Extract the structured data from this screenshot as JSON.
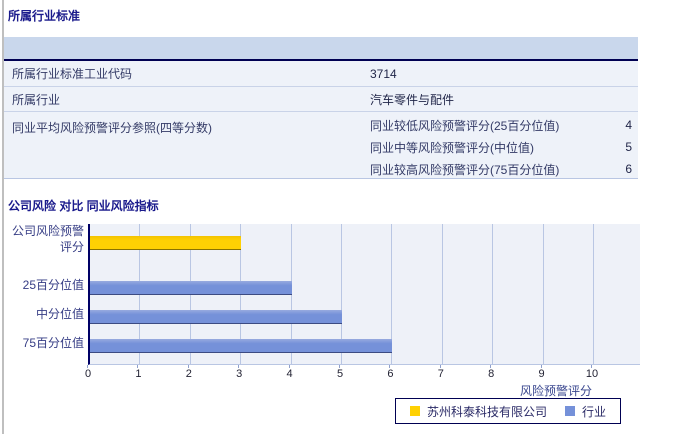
{
  "sections": {
    "industry_standard_title": "所属行业标准",
    "comparison_title": "公司风险 对比 同业风险指标"
  },
  "industry_table": {
    "rows": [
      {
        "label": "所属行业标准工业代码",
        "value": "3714"
      },
      {
        "label": "所属行业",
        "value": "汽车零件与配件"
      }
    ],
    "quartile_row": {
      "label": "同业平均风险预警评分参照(四等分数)",
      "items": [
        {
          "label": "同业较低风险预警评分(25百分位值)",
          "value": "4"
        },
        {
          "label": "同业中等风险预警评分(中位值)",
          "value": "5"
        },
        {
          "label": "同业较高风险预警评分(75百分位值)",
          "value": "6"
        }
      ]
    }
  },
  "chart_data": {
    "type": "bar",
    "orientation": "horizontal",
    "categories": [
      "公司风险预警评分",
      "25百分位值",
      "中分位值",
      "75百分位值"
    ],
    "category_display": [
      [
        "公司风险预警",
        "评分"
      ],
      [
        "25百分位值"
      ],
      [
        "中分位值"
      ],
      [
        "75百分位值"
      ]
    ],
    "series": [
      {
        "name": "苏州科泰科技有限公司",
        "color": "#FFD103",
        "color_top": "#F3C300",
        "color_edge": "#8A7200",
        "values": [
          3,
          null,
          null,
          null
        ]
      },
      {
        "name": "行业",
        "color": "#7591D9",
        "color_top": "#97AADF",
        "color_edge": "#3C4B82",
        "values": [
          null,
          4,
          5,
          6
        ]
      }
    ],
    "xlabel": "风险预警评分",
    "xlim": [
      0,
      10
    ],
    "xticks": [
      0,
      1,
      2,
      3,
      4,
      5,
      6,
      7,
      8,
      9,
      10
    ],
    "grid": true,
    "legend_position": "bottom",
    "plot_bg": "#EEF1F8",
    "gridline_color": "#B9C6E3"
  }
}
